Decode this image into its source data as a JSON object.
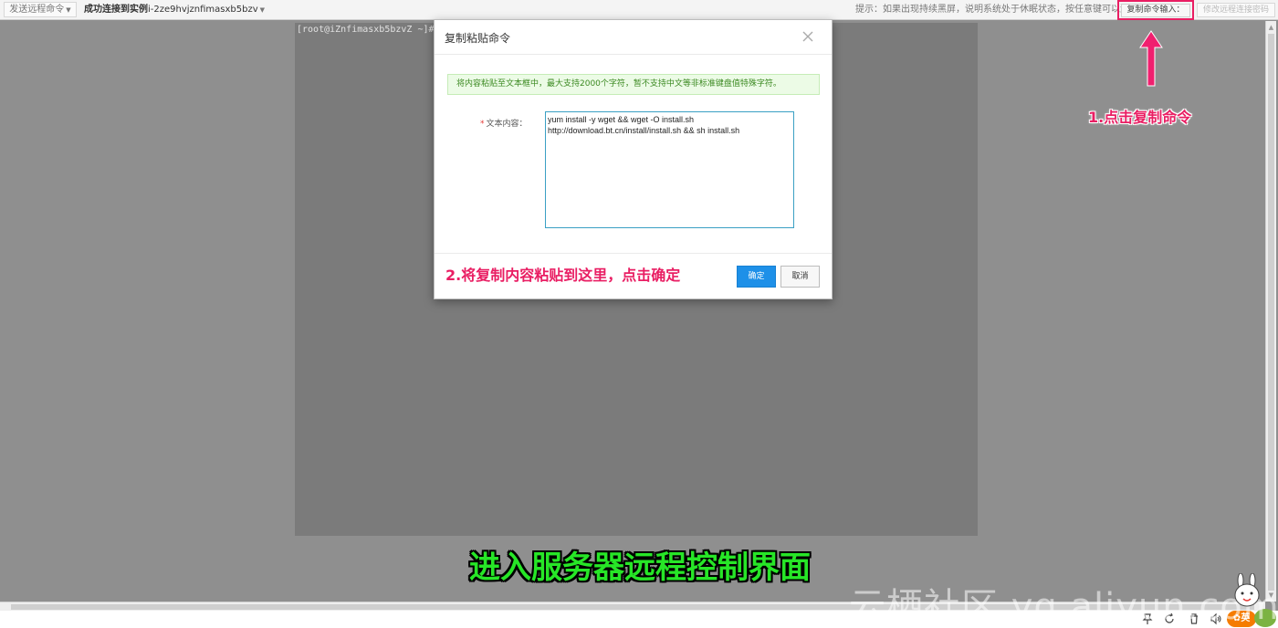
{
  "topbar": {
    "send_command_label": "发送远程命令",
    "status_prefix": "成功连接到实例",
    "instance_id": "i-2ze9hvjznfimasxb5bzv",
    "hint": "提示：如果出现持续黑屏，说明系统处于休眠状态，按任意键可以激活。",
    "copy_command_label": "复制命令输入：",
    "change_password_label": "修改远程连接密码"
  },
  "terminal": {
    "prompt": "[root@iZnfimasxb5bzvZ ~]#"
  },
  "modal": {
    "title": "复制粘贴命令",
    "notice": "将内容粘贴至文本框中，最大支持2000个字符，暂不支持中文等非标准键盘值特殊字符。",
    "required_mark": "*",
    "field_label": "文本内容：",
    "textarea_value": "yum install -y wget && wget -O install.sh\nhttp://download.bt.cn/install/install.sh && sh install.sh",
    "ok_label": "确定",
    "cancel_label": "取消"
  },
  "annotations": {
    "step1": "1.点击复制命令",
    "step2": "2.将复制内容粘贴到这里，点击确定",
    "caption": "进入服务器远程控制界面",
    "watermark": "云栖社区 yq.aliyun.com",
    "accent_pink": "#e91e63",
    "accent_green": "#27e627"
  },
  "taskbar": {
    "logo_text": "英",
    "tray_icons": [
      "pin-icon",
      "refresh-icon",
      "trash-icon",
      "speaker-icon",
      "network-icon"
    ]
  }
}
